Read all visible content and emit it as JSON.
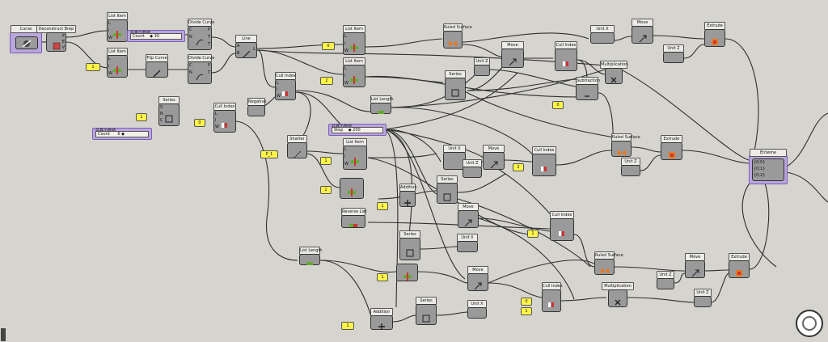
{
  "labels": {
    "curve": "Curve",
    "deconstruct_brep": "Deconstruct Brep",
    "list_item": "List Item",
    "divide_curve": "Divide Curve",
    "flip_curve": "Flip Curve",
    "line": "Line",
    "cull_index": "Cull Index",
    "negative": "Negative",
    "series": "Series",
    "shatter": "Shatter",
    "list_length": "List Length",
    "ruled_surface": "Ruled Surface",
    "move": "Move",
    "unit_z": "Unit Z",
    "unit_x": "Unit X",
    "unit_y": "Unit Y",
    "extrude": "Extrude",
    "multiplication": "Multiplication",
    "subtraction": "Subtraction",
    "addition": "Addition",
    "reverse_list": "Reverse List",
    "entwine": "Entwine"
  },
  "sliders": {
    "s1": {
      "title": "任意の数値",
      "label": "Count",
      "value": "◆ 30"
    },
    "s2": {
      "title": "任意の数値",
      "label": "Count",
      "value": "6 ◆"
    },
    "s3": {
      "title": "任意の数値",
      "label": "Step",
      "value": "◆ 200"
    }
  },
  "panels": {
    "p1": "1",
    "p2": "0",
    "p3": "2",
    "p4": "1",
    "p5": "0",
    "p6": "1",
    "p7": "1",
    "p8": "0",
    "p9": "2",
    "p10": "1",
    "p11": "P_1",
    "p12": "1",
    "p13": "1",
    "p14": "0",
    "p15": "1",
    "p16": "1",
    "p17": "0",
    "p18": "1",
    "p19": "0"
  },
  "pins": {
    "A": "A",
    "B": "B",
    "C": "C",
    "D": "D",
    "E": "E",
    "F": "F",
    "G": "G",
    "I": "I",
    "L": "L",
    "N": "N",
    "P": "P",
    "R": "R",
    "S": "S",
    "T": "T",
    "V": "V",
    "W": "W",
    "X": "X",
    "Y": "Y",
    "i": "i",
    "j": "j",
    "k": "k",
    "c0": "{0;0}",
    "c1": "{0;1}",
    "c2": "{0;2}"
  },
  "colors": {
    "canvas": "#d6d4ce",
    "component": "#9a9a9a",
    "panel": "#fff44a",
    "slider": "#b9a6dd",
    "wire": "#2e2e2e"
  }
}
